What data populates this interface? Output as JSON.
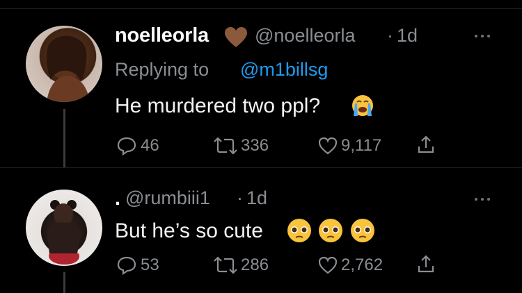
{
  "tweets": [
    {
      "display_name": "noelleorla",
      "heart_emoji": "brown-heart-icon",
      "handle": "@noelleorla",
      "dot": "·",
      "time": "1d",
      "replying_prefix": "Replying to ",
      "replying_to": "@m1billsg",
      "text": "He murdered two ppl?",
      "text_emoji": "loudly-crying-face-icon",
      "replies": "46",
      "retweets": "336",
      "likes": "9,117"
    },
    {
      "display_name": ".",
      "handle": "@rumbiii1",
      "dot": "·",
      "time": "1d",
      "text": "But he’s so cute",
      "text_emoji": "pleading-face-icon",
      "replies": "53",
      "retweets": "286",
      "likes": "2,762"
    }
  ],
  "colors": {
    "background": "#000000",
    "text": "#f3f3f3",
    "muted": "#8a8d91",
    "link": "#1d9bf0",
    "brown_heart": "#8b5a3c"
  }
}
